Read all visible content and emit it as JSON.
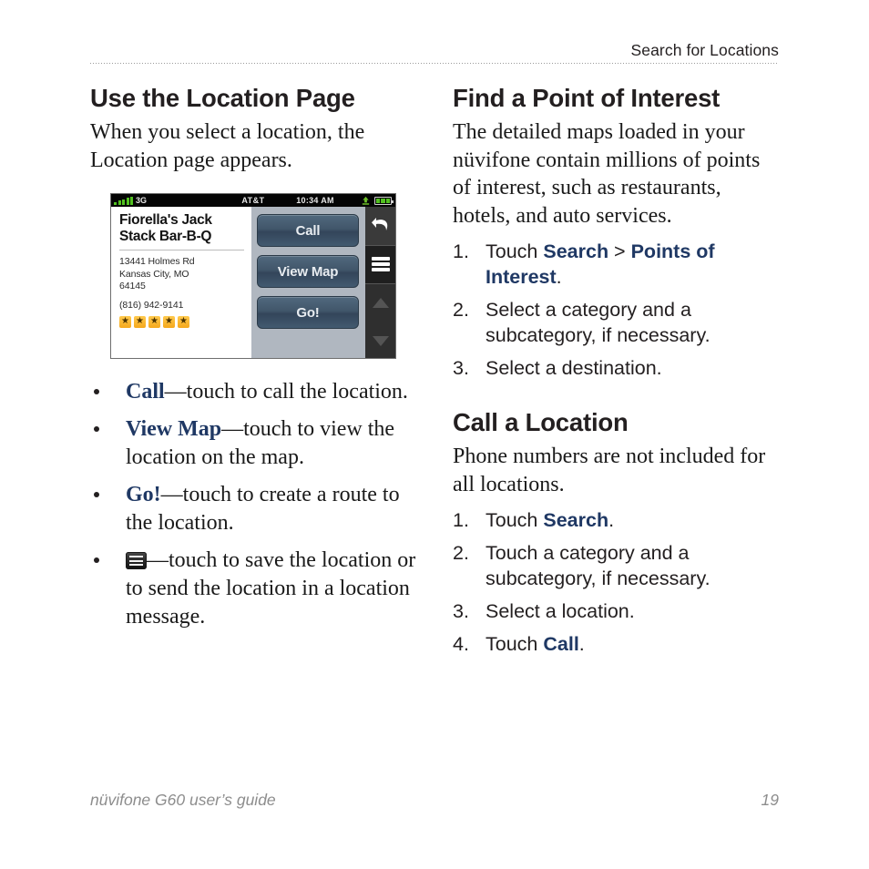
{
  "running_head": "Search for Locations",
  "footer": {
    "guide_title": "nüvifone G60 user’s guide",
    "page_number": "19"
  },
  "colors": {
    "term_blue": "#1f3864",
    "heading_black": "#231f20",
    "footer_gray": "#8d8d8d",
    "device_button": "#41566a",
    "star_gold": "#f5a81c",
    "signal_green": "#52c120"
  },
  "left_column": {
    "heading": "Use the Location Page",
    "intro": "When you select a location, the Location page appears.",
    "figure": {
      "status_bar": {
        "network": "3G",
        "carrier": "AT&T",
        "time": "10:34 AM",
        "signal_icon": "signal-bars-icon",
        "sync_icon": "sync-icon",
        "battery_icon": "battery-icon"
      },
      "poi": {
        "name_line1": "Fiorella's Jack",
        "name_line2": "Stack Bar-B-Q",
        "address_line1": "13441 Holmes Rd",
        "address_line2": "Kansas City, MO",
        "address_line3": "64145",
        "phone": "(816) 942-9141",
        "rating_stars": 5
      },
      "buttons": [
        "Call",
        "View Map",
        "Go!"
      ],
      "rail": {
        "back_icon": "back-arrow-icon",
        "menu_icon": "menu-icon",
        "scroll_up_icon": "scroll-up-icon",
        "scroll_down_icon": "scroll-down-icon"
      }
    },
    "bullets": [
      {
        "term": "Call",
        "icon": null,
        "text": "—touch to call the location."
      },
      {
        "term": "View Map",
        "icon": null,
        "text": "—touch to view the location on the map."
      },
      {
        "term": "Go!",
        "icon": null,
        "text": "—touch to create a route to the location."
      },
      {
        "term": null,
        "icon": "menu-icon",
        "text": "—touch to save the location or to send the location in a location message."
      }
    ]
  },
  "right_column": {
    "section1": {
      "heading": "Find a Point of Interest",
      "intro": "The detailed maps loaded in your nüvifone contain millions of points of interest, such as restaurants, hotels, and auto services.",
      "steps": [
        {
          "num": "1.",
          "prefix": "Touch ",
          "term1": "Search",
          "mid": " > ",
          "term2": "Points of Interest",
          "suffix": "."
        },
        {
          "num": "2.",
          "prefix": "Select a category and a subcategory, if necessary.",
          "term1": null,
          "mid": null,
          "term2": null,
          "suffix": null
        },
        {
          "num": "3.",
          "prefix": "Select a destination.",
          "term1": null,
          "mid": null,
          "term2": null,
          "suffix": null
        }
      ]
    },
    "section2": {
      "heading": "Call a Location",
      "intro": "Phone numbers are not included for all locations.",
      "steps": [
        {
          "num": "1.",
          "prefix": "Touch ",
          "term1": "Search",
          "mid": null,
          "term2": null,
          "suffix": "."
        },
        {
          "num": "2.",
          "prefix": "Touch a category and a subcategory, if necessary.",
          "term1": null,
          "mid": null,
          "term2": null,
          "suffix": null
        },
        {
          "num": "3.",
          "prefix": "Select a location.",
          "term1": null,
          "mid": null,
          "term2": null,
          "suffix": null
        },
        {
          "num": "4.",
          "prefix": "Touch ",
          "term1": "Call",
          "mid": null,
          "term2": null,
          "suffix": "."
        }
      ]
    }
  }
}
